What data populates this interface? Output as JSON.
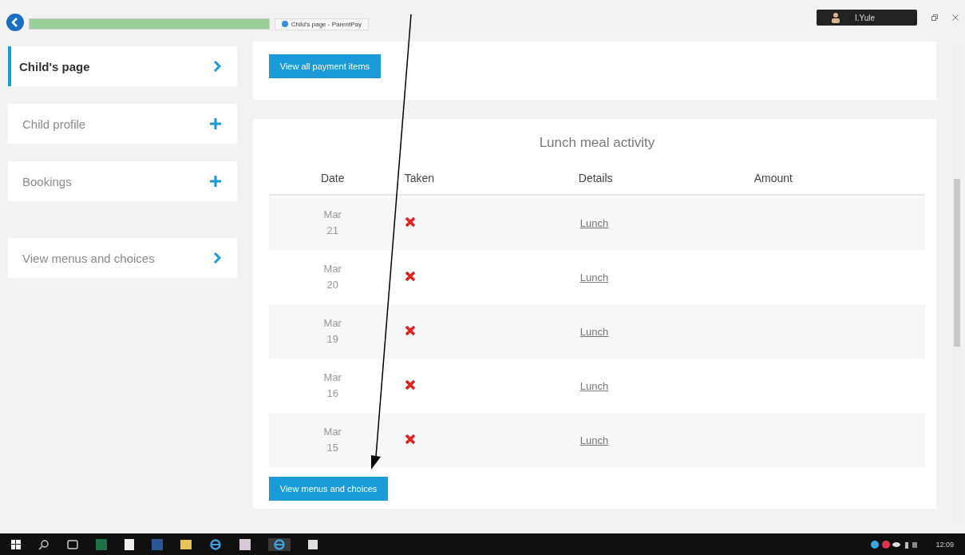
{
  "browser": {
    "tab_title": "Child's page - ParentPay",
    "user": "I.Yule"
  },
  "sidebar": {
    "items": [
      {
        "label": "Child's page",
        "kind": "link",
        "selected": true
      },
      {
        "label": "Child profile",
        "kind": "expandable",
        "selected": false
      },
      {
        "label": "Bookings",
        "kind": "expandable",
        "selected": false
      },
      {
        "label": "View menus and choices",
        "kind": "link",
        "selected": false
      }
    ]
  },
  "top_button": "View all payment items",
  "lunch": {
    "title": "Lunch meal activity",
    "columns": [
      "Date",
      "Taken",
      "Details",
      "Amount"
    ],
    "rows": [
      {
        "month": "Mar",
        "day": "21",
        "taken": false,
        "details": "Lunch"
      },
      {
        "month": "Mar",
        "day": "20",
        "taken": false,
        "details": "Lunch"
      },
      {
        "month": "Mar",
        "day": "19",
        "taken": false,
        "details": "Lunch"
      },
      {
        "month": "Mar",
        "day": "16",
        "taken": false,
        "details": "Lunch"
      },
      {
        "month": "Mar",
        "day": "15",
        "taken": false,
        "details": "Lunch"
      }
    ],
    "button": "View menus and choices"
  },
  "taskbar": {
    "clock": "12:09"
  }
}
